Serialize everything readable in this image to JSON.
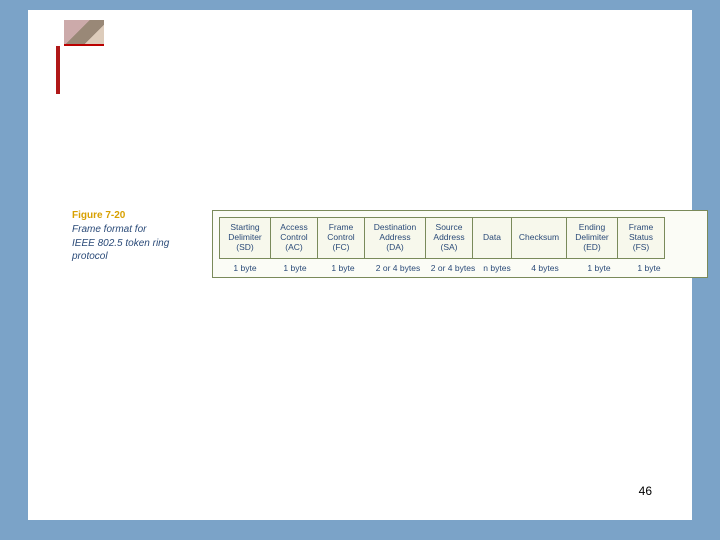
{
  "figure": {
    "number": "Figure 7-20",
    "caption_line1": "Frame format for",
    "caption_line2": "IEEE 802.5 token ring",
    "caption_line3": "protocol"
  },
  "frame": {
    "fields": [
      {
        "name": "Starting",
        "sub": "Delimiter",
        "abbr": "(SD)",
        "size": "1 byte"
      },
      {
        "name": "Access",
        "sub": "Control",
        "abbr": "(AC)",
        "size": "1 byte"
      },
      {
        "name": "Frame",
        "sub": "Control",
        "abbr": "(FC)",
        "size": "1 byte"
      },
      {
        "name": "Destination",
        "sub": "Address",
        "abbr": "(DA)",
        "size": "2 or 4 bytes"
      },
      {
        "name": "Source",
        "sub": "Address",
        "abbr": "(SA)",
        "size": "2 or 4 bytes"
      },
      {
        "name": "Data",
        "sub": "",
        "abbr": "",
        "size": "n bytes"
      },
      {
        "name": "Checksum",
        "sub": "",
        "abbr": "",
        "size": "4 bytes"
      },
      {
        "name": "Ending",
        "sub": "Delimiter",
        "abbr": "(ED)",
        "size": "1 byte"
      },
      {
        "name": "Frame",
        "sub": "Status",
        "abbr": "(FS)",
        "size": "1 byte"
      }
    ]
  },
  "page_number": "46"
}
